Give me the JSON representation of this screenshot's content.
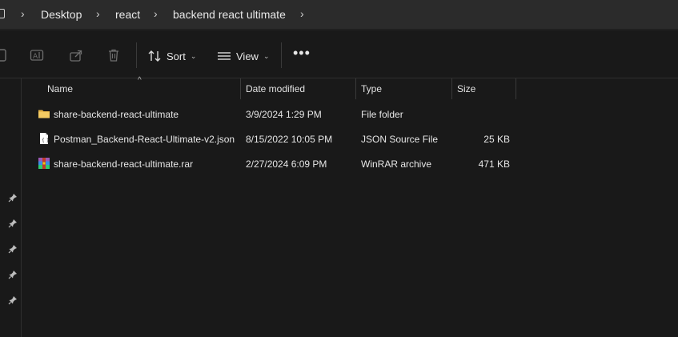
{
  "breadcrumb": {
    "items": [
      "Desktop",
      "react",
      "backend react ultimate"
    ]
  },
  "toolbar": {
    "sort_label": "Sort",
    "view_label": "View",
    "more_label": "•••"
  },
  "columns": {
    "name": "Name",
    "date": "Date modified",
    "type": "Type",
    "size": "Size"
  },
  "files": [
    {
      "name": "share-backend-react-ultimate",
      "date": "3/9/2024 1:29 PM",
      "type": "File folder",
      "size": "",
      "icon": "folder-icon"
    },
    {
      "name": "Postman_Backend-React-Ultimate-v2.json",
      "date": "8/15/2022 10:05 PM",
      "type": "JSON Source File",
      "size": "25 KB",
      "icon": "json-file-icon"
    },
    {
      "name": "share-backend-react-ultimate.rar",
      "date": "2/27/2024 6:09 PM",
      "type": "WinRAR archive",
      "size": "471 KB",
      "icon": "winrar-icon"
    }
  ],
  "colors": {
    "background": "#191919",
    "addressbar": "#2b2b2b",
    "folder": "#f2c55c"
  }
}
